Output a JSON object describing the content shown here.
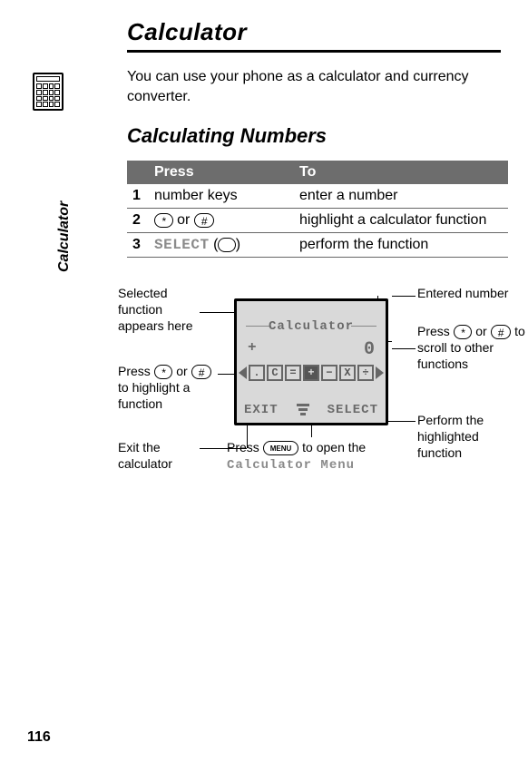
{
  "page_number": "116",
  "side_label": "Calculator",
  "title": "Calculator",
  "intro": "You can use your phone as a calculator and currency converter.",
  "section_heading": "Calculating Numbers",
  "table": {
    "col_press": "Press",
    "col_to": "To",
    "rows": [
      {
        "num": "1",
        "press": "number keys",
        "to": "enter a number"
      },
      {
        "num": "2",
        "press_glyph1": "*",
        "press_or": " or ",
        "press_glyph2": "#",
        "to": "highlight a calculator function"
      },
      {
        "num": "3",
        "press_select": "SELECT",
        "press_paren_open": " (",
        "press_glyph3": " ",
        "press_paren_close": ")",
        "to": "perform the function"
      }
    ]
  },
  "screen": {
    "title": "Calculator",
    "indicator": "+",
    "display_value": "0",
    "functions": [
      ".",
      "C",
      "=",
      "+",
      "−",
      "X",
      "÷"
    ],
    "active_index": 3,
    "soft_left": "EXIT",
    "soft_right": "SELECT"
  },
  "callouts": {
    "c_left1": "Selected function appears here",
    "c_left2_a": "Press ",
    "c_left2_b": " or ",
    "c_left2_c": " to highlight a function",
    "c_left3": "Exit the calculator",
    "c_bottom_a": "Press ",
    "c_bottom_b": " to open the ",
    "c_bottom_menu": "Calculator Menu",
    "c_right1": "Entered number",
    "c_right2_a": "Press ",
    "c_right2_b": " or ",
    "c_right2_c": " to scroll to other functions",
    "c_right3": "Perform the highlighted function",
    "star": "*",
    "hash": "#",
    "menu_label": "MENU"
  }
}
